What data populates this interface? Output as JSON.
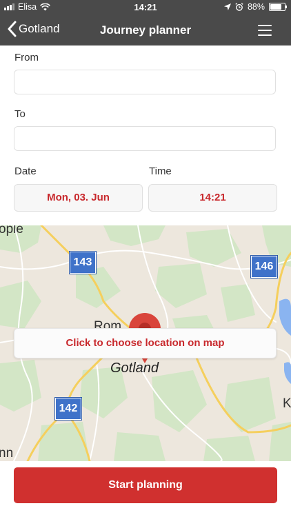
{
  "status_bar": {
    "carrier": "Elisa",
    "time": "14:21",
    "battery_percent": "88%",
    "battery_level": 0.88
  },
  "nav": {
    "back_label": "Gotland",
    "title": "Journey planner"
  },
  "form": {
    "from_label": "From",
    "from_value": "",
    "to_label": "To",
    "to_value": "",
    "date_label": "Date",
    "date_value": "Mon, 03. Jun",
    "time_label": "Time",
    "time_value": "14:21"
  },
  "map": {
    "choose_label": "Click to choose location on map",
    "place_label": "Gotland",
    "partial_labels": [
      "ople",
      "Rom",
      "K",
      "nn"
    ],
    "road_shields": [
      "143",
      "146",
      "142"
    ],
    "colors": {
      "land": "#ede7dd",
      "forest": "#d3e6c6",
      "road_major": "#f5cf5d",
      "road_minor": "#ffffff",
      "water": "#8ab4f0",
      "shield": "#3f72c9",
      "pin": "#d9453b"
    }
  },
  "actions": {
    "start_label": "Start planning"
  },
  "colors": {
    "accent": "#c8282c",
    "header_bg": "#4a4a4a",
    "primary_button": "#d0302f"
  },
  "icons": [
    "signal-icon",
    "wifi-icon",
    "location-arrow-icon",
    "alarm-icon",
    "battery-icon",
    "chevron-left-icon",
    "hamburger-menu-icon",
    "map-pin-icon"
  ]
}
